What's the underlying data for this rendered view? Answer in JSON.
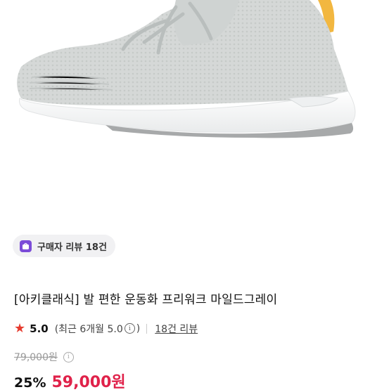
{
  "review_badge": {
    "label": "구매자 리뷰 18건",
    "icon": "review-bag-icon",
    "accent": "#7b4bd8"
  },
  "product": {
    "title": "[아키클래식] 발 편한 운동화 프리워크 마일드그레이",
    "rating": "5.0",
    "recent_rating": "(최근 6개월 5.0",
    "recent_close": ")",
    "info_glyph": "i",
    "review_link": "18건 리뷰",
    "original_price": "79,000원",
    "discount": "25%",
    "sale_price": "59,000원"
  },
  "colors": {
    "star": "#e63b2e",
    "sale_price": "#e0224a"
  }
}
